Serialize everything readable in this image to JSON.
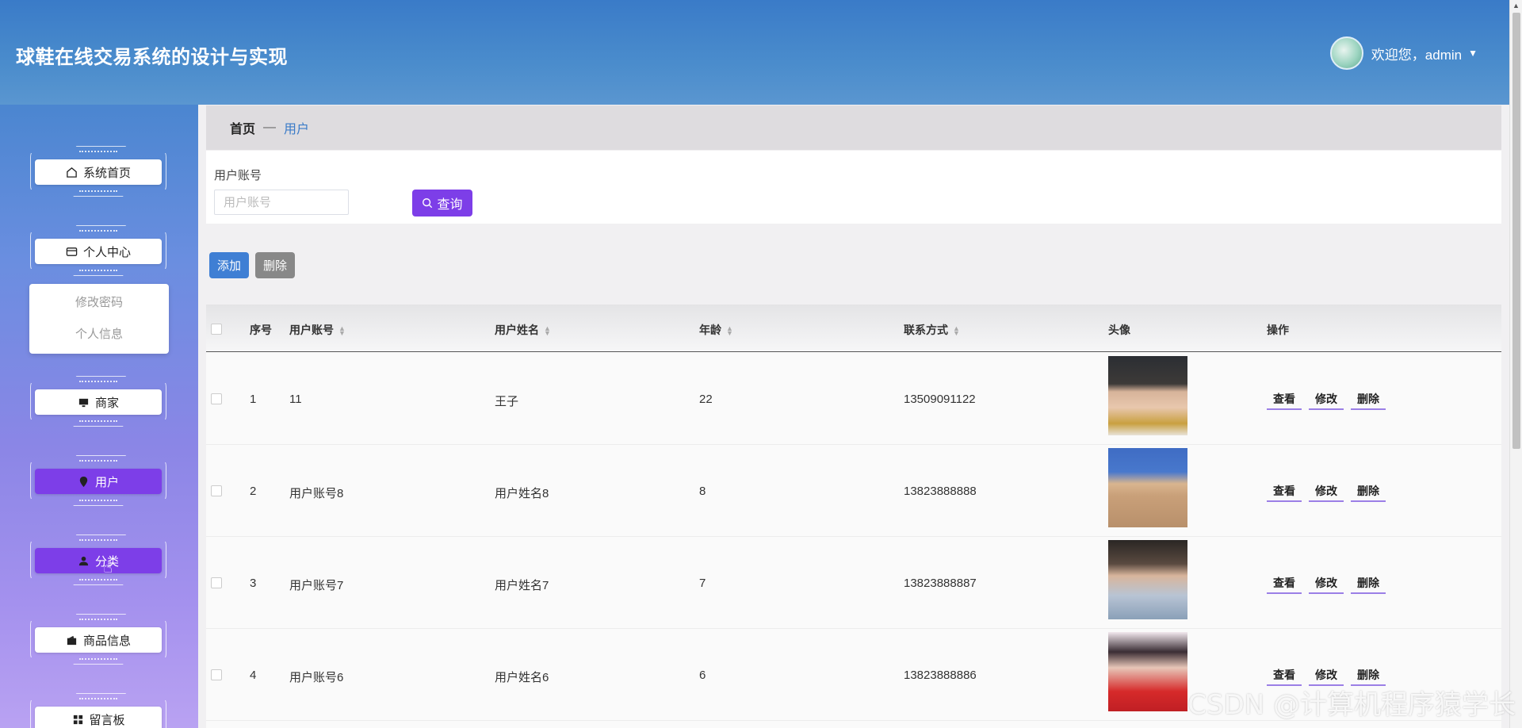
{
  "header": {
    "title": "球鞋在线交易系统的设计与实现",
    "welcome": "欢迎您，admin"
  },
  "sidebar": {
    "items": [
      {
        "label": "系统首页",
        "icon": "home-icon",
        "active": false
      },
      {
        "label": "个人中心",
        "icon": "card-icon",
        "active": false
      },
      {
        "label": "商家",
        "icon": "monitor-icon",
        "active": false
      },
      {
        "label": "用户",
        "icon": "location-pin-icon",
        "active": true
      },
      {
        "label": "分类",
        "icon": "person-icon",
        "active": true
      },
      {
        "label": "商品信息",
        "icon": "wallet-icon",
        "active": false
      },
      {
        "label": "留言板",
        "icon": "grid-icon",
        "active": false
      }
    ],
    "submenu": [
      "修改密码",
      "个人信息"
    ]
  },
  "breadcrumb": {
    "home": "首页",
    "separator": "—",
    "current": "用户"
  },
  "search": {
    "label": "用户账号",
    "placeholder": "用户账号",
    "button": "查询"
  },
  "actions": {
    "add": "添加",
    "delete": "删除"
  },
  "table": {
    "columns": [
      "序号",
      "用户账号",
      "用户姓名",
      "年龄",
      "联系方式",
      "头像",
      "操作"
    ],
    "rows": [
      {
        "index": "1",
        "account": "11",
        "name": "王子",
        "age": "22",
        "phone": "13509091122"
      },
      {
        "index": "2",
        "account": "用户账号8",
        "name": "用户姓名8",
        "age": "8",
        "phone": "13823888888"
      },
      {
        "index": "3",
        "account": "用户账号7",
        "name": "用户姓名7",
        "age": "7",
        "phone": "13823888887"
      },
      {
        "index": "4",
        "account": "用户账号6",
        "name": "用户姓名6",
        "age": "6",
        "phone": "13823888886"
      }
    ],
    "ops": {
      "view": "查看",
      "edit": "修改",
      "delete": "删除"
    }
  },
  "watermark": "CSDN @计算机程序猿学长",
  "colors": {
    "primary": "#7d3ee8",
    "header": "#3a7bc8",
    "add": "#3f7fd4",
    "delete": "#888888"
  }
}
